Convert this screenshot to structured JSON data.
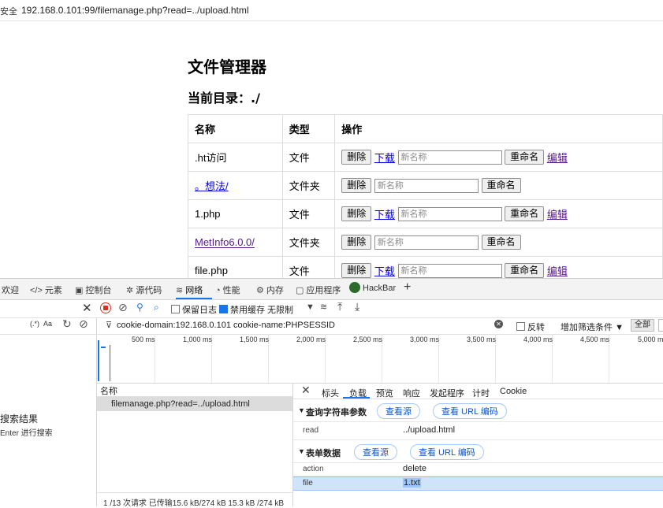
{
  "address_bar": {
    "security": "安全",
    "url": "192.168.0.101:99/filemanage.php?read=../upload.html"
  },
  "page": {
    "title": "文件管理器",
    "current_dir": "当前目录：./",
    "table": {
      "headers": [
        "名称",
        "类型",
        "操作"
      ],
      "rows": [
        {
          "name": ".ht访问",
          "type": "文件"
        },
        {
          "name": "。想法/",
          "type": "文件夹"
        },
        {
          "name": "1.php",
          "type": "文件"
        },
        {
          "name": "MetInfo6.0.0/",
          "type": "文件夹"
        },
        {
          "name": "file.php",
          "type": "文件"
        }
      ],
      "delete": "删除",
      "download": "下载",
      "rename_placeholder": "新名称",
      "rename": "重命名",
      "edit": "编辑"
    }
  },
  "devtools": {
    "tabs": [
      "欢迎",
      "元素",
      "控制台",
      "源代码",
      "网络",
      "性能",
      "内存",
      "应用程序",
      "HackBar"
    ],
    "active_tab": "网络",
    "toolbar": {
      "preserve_log": "保留日志",
      "disable_cache": "禁用缓存",
      "throttle": "无限制"
    },
    "search": {
      "regex": "(.*)",
      "case": "Aa"
    },
    "filter": {
      "value": "cookie-domain:192.168.0.101 cookie-name:PHPSESSID",
      "invert": "反转",
      "more_filters": "增加筛选条件",
      "all": "全部"
    },
    "timeline_labels": [
      "500 ms",
      "1,000 ms",
      "1,500 ms",
      "2,000 ms",
      "2,500 ms",
      "3,000 ms",
      "3,500 ms",
      "4,000 ms",
      "4,500 ms",
      "5,000 ms"
    ],
    "left_panel": {
      "search_results": "搜索结果",
      "hint": "Enter 进行搜索"
    },
    "request_list": {
      "header": "名称",
      "items": [
        "filemanage.php?read=../upload.html"
      ],
      "status": "1 /13 次请求  已传输15.6 kB/274 kB  15.3 kB /274 kB"
    },
    "detail": {
      "tabs": [
        "标头",
        "负载",
        "预览",
        "响应",
        "发起程序",
        "计时",
        "Cookie"
      ],
      "active_tab": "负载",
      "query_section": "查询字符串参数",
      "form_section": "表单数据",
      "view_source": "查看源",
      "view_url_encoded": "查看 URL 编码",
      "query_params": [
        {
          "key": "read",
          "value": "../upload.html"
        }
      ],
      "form_params": [
        {
          "key": "action",
          "value": "delete"
        },
        {
          "key": "file",
          "value": "1.txt"
        }
      ]
    }
  }
}
